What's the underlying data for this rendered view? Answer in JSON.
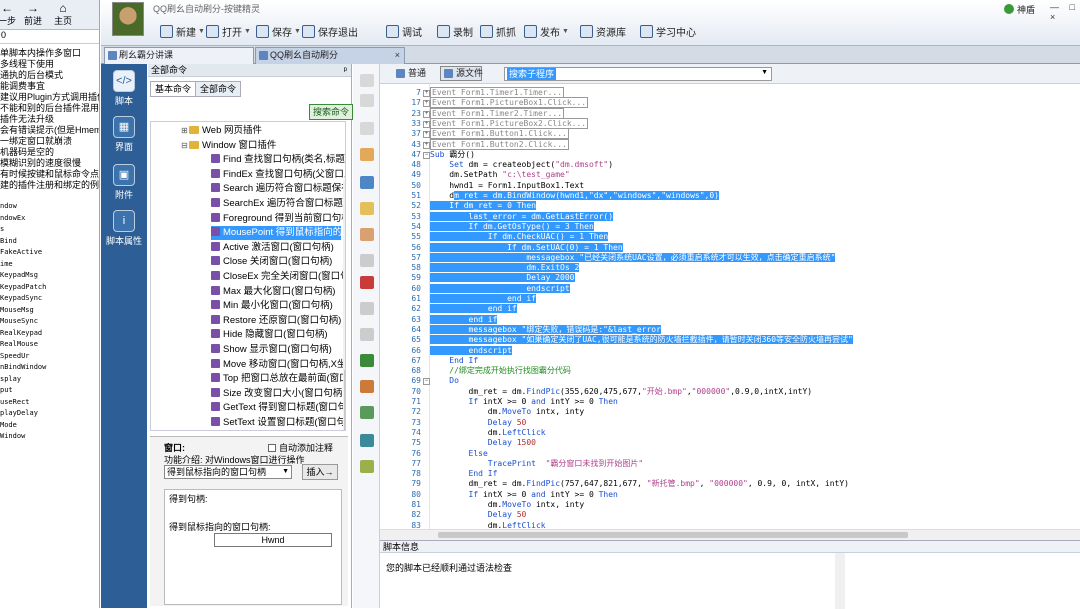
{
  "left_window": {
    "nav": {
      "back": "一步",
      "forward": "前进",
      "home": "主页"
    },
    "address": "0",
    "lines": [
      "单脚本内操作多窗口",
      "多线程下使用",
      "通执的后台模式",
      "能调费事宜",
      "建议用Plugin方式调用插件",
      "不能和别的后台插件混用",
      "插件无法升级",
      "会有错误提示(但是HmemDC",
      "一绑定窗口就崩溃",
      "机器码是空的",
      "模糊识别的速度很慢",
      "有时候按键和鼠标命令点击无效",
      "建的插件注册和绑定的例子"
    ],
    "api_lines": [
      "ndow",
      "ndowEx",
      "s",
      "Bind",
      "FakeActive",
      "ime",
      "KeypadMsg",
      "KeypadPatch",
      "KeypadSync",
      "MouseMsg",
      "MouseSync",
      "RealKeypad",
      "RealMouse",
      "SpeedUr",
      "nBindWindow",
      "",
      "splay",
      "put",
      "useRect",
      "playDelay",
      "Mode",
      "Window"
    ]
  },
  "app": {
    "title": "QQ刷幺自动刷分-按键精灵",
    "help_label": "神盾",
    "window_controls": "— □ ×",
    "toolbar": [
      {
        "label": "新建",
        "icon": "new-file-icon",
        "caret": true
      },
      {
        "label": "打开",
        "icon": "open-folder-icon",
        "caret": true
      },
      {
        "label": "保存",
        "icon": "save-icon",
        "caret": true
      },
      {
        "label": "保存退出",
        "icon": "save-exit-icon",
        "caret": false
      },
      {
        "label": "调试",
        "icon": "debug-icon",
        "caret": false
      },
      {
        "label": "录制",
        "icon": "record-icon",
        "caret": false
      },
      {
        "label": "抓抓",
        "icon": "capture-icon",
        "caret": false
      },
      {
        "label": "发布",
        "icon": "publish-icon",
        "caret": true
      },
      {
        "label": "资源库",
        "icon": "resource-icon",
        "caret": false
      },
      {
        "label": "学习中心",
        "icon": "learning-icon",
        "caret": false
      }
    ],
    "tabs": [
      {
        "label": "刷幺霸分讲课",
        "active": false
      },
      {
        "label": "QQ刷幺自动刷分",
        "active": true
      }
    ]
  },
  "sidebar": [
    {
      "label": "脚本",
      "icon": "script-icon",
      "active": true
    },
    {
      "label": "界面",
      "icon": "interface-icon",
      "active": false
    },
    {
      "label": "附件",
      "icon": "attachment-icon",
      "active": false
    },
    {
      "label": "脚本属性",
      "icon": "info-icon",
      "active": false
    }
  ],
  "commands": {
    "header": "全部命令",
    "pin": "ᵖ",
    "tabs": [
      "基本命令",
      "全部命令"
    ],
    "search_button": "搜索命令",
    "tree": [
      {
        "label": "Web 网页插件",
        "level": 0,
        "type": "folder",
        "expander": "+"
      },
      {
        "label": "Window 窗口插件",
        "level": 0,
        "type": "folder",
        "expander": "−"
      },
      {
        "label": "Find 查找窗口句柄(类名,标题)",
        "level": 1,
        "type": "cmd"
      },
      {
        "label": "FindEx 查找窗口句柄(父窗口,子",
        "level": 1,
        "type": "cmd"
      },
      {
        "label": "Search 遍历符合窗口标题保存",
        "level": 1,
        "type": "cmd"
      },
      {
        "label": "SearchEx 遍历符合窗口标题保",
        "level": 1,
        "type": "cmd"
      },
      {
        "label": "Foreground 得到当前窗口句柄",
        "level": 1,
        "type": "cmd"
      },
      {
        "label": "MousePoint 得到鼠标指向的窗",
        "level": 1,
        "type": "cmd",
        "selected": true
      },
      {
        "label": "Active 激活窗口(窗口句柄)",
        "level": 1,
        "type": "cmd"
      },
      {
        "label": "Close 关闭窗口(窗口句柄)",
        "level": 1,
        "type": "cmd"
      },
      {
        "label": "CloseEx 完全关闭窗口(窗口句",
        "level": 1,
        "type": "cmd"
      },
      {
        "label": "Max 最大化窗口(窗口句柄)",
        "level": 1,
        "type": "cmd"
      },
      {
        "label": "Min 最小化窗口(窗口句柄)",
        "level": 1,
        "type": "cmd"
      },
      {
        "label": "Restore 还原窗口(窗口句柄)",
        "level": 1,
        "type": "cmd"
      },
      {
        "label": "Hide 隐藏窗口(窗口句柄)",
        "level": 1,
        "type": "cmd"
      },
      {
        "label": "Show 显示窗口(窗口句柄)",
        "level": 1,
        "type": "cmd"
      },
      {
        "label": "Move 移动窗口(窗口句柄,X坐标",
        "level": 1,
        "type": "cmd"
      },
      {
        "label": "Top 把窗口总放在最前面(窗口",
        "level": 1,
        "type": "cmd"
      },
      {
        "label": "Size 改变窗口大小(窗口句柄,宽",
        "level": 1,
        "type": "cmd"
      },
      {
        "label": "GetText 得到窗口标题(窗口句",
        "level": 1,
        "type": "cmd"
      },
      {
        "label": "SetText 设置窗口标题(窗口句",
        "level": 1,
        "type": "cmd"
      }
    ],
    "info": {
      "title": "窗口:",
      "auto_comment": "自动添加注释",
      "desc": "功能介绍: 对Windows窗口进行操作",
      "select_value": "得到鼠标指向的窗口句柄",
      "insert_button": "插入→",
      "group_title": "得到句柄:",
      "field_label": "得到鼠标指向的窗口句柄:",
      "field_value": "Hwnd"
    }
  },
  "editor": {
    "view_normal": "普通",
    "view_source": "源文件",
    "sub_select": "搜索子程序",
    "lines": [
      {
        "n": "7",
        "fold": "+",
        "t": [
          [
            "bx",
            "Event Form1.Timer1.Timer..."
          ]
        ]
      },
      {
        "n": "17",
        "fold": "+",
        "t": [
          [
            "bx",
            "Event Form1.PictureBox1.Click..."
          ]
        ]
      },
      {
        "n": "23",
        "fold": "+",
        "t": [
          [
            "bx",
            "Event Form1.Timer2.Timer..."
          ]
        ]
      },
      {
        "n": "33",
        "fold": "+",
        "t": [
          [
            "bx",
            "Event Form1.PictureBox2.Click..."
          ]
        ]
      },
      {
        "n": "37",
        "fold": "+",
        "t": [
          [
            "bx",
            "Event Form1.Button1.Click..."
          ]
        ]
      },
      {
        "n": "43",
        "fold": "+",
        "t": [
          [
            "bx",
            "Event Form1.Button2.Click..."
          ]
        ]
      },
      {
        "n": "47",
        "fold": "−",
        "t": [
          [
            "kw",
            "Sub "
          ],
          [
            "",
            "霸分()"
          ]
        ]
      },
      {
        "n": "48",
        "t": [
          [
            "",
            "    "
          ],
          [
            "kw",
            "Set "
          ],
          [
            "",
            "dm = createobject("
          ],
          [
            "st",
            "\"dm.dmsoft\""
          ],
          [
            "",
            ")"
          ]
        ]
      },
      {
        "n": "49",
        "t": [
          [
            "",
            "    dm.SetPath "
          ],
          [
            "st",
            "\"c:\\test_game\""
          ]
        ]
      },
      {
        "n": "50",
        "t": [
          [
            "",
            "    hwnd1 = Form1.InputBox1.Text"
          ]
        ]
      },
      {
        "n": "51",
        "t": [
          [
            "",
            "    d"
          ],
          [
            "hl",
            "m_ret = dm.BindWindow(hwnd1,\"dx\",\"windows\",\"windows\",0)"
          ]
        ]
      },
      {
        "n": "52",
        "t": [
          [
            "hl",
            "    If dm_ret = 0 Then"
          ]
        ]
      },
      {
        "n": "53",
        "t": [
          [
            "hl",
            "        last_error = dm.GetLastError()"
          ]
        ]
      },
      {
        "n": "54",
        "t": [
          [
            "hl",
            "        If dm.GetOsType() = 3 Then"
          ]
        ]
      },
      {
        "n": "55",
        "t": [
          [
            "hl",
            "            If dm.CheckUAC() = 1 Then"
          ]
        ]
      },
      {
        "n": "56",
        "t": [
          [
            "hl",
            "                If dm.SetUAC(0) = 1 Then"
          ]
        ]
      },
      {
        "n": "57",
        "t": [
          [
            "hl",
            "                    messagebox \"已经关闭系统UAC设置，必须重启系统才可以生效，点击确定重启系统\""
          ]
        ]
      },
      {
        "n": "58",
        "t": [
          [
            "hl",
            "                    dm.ExitOs 2"
          ]
        ]
      },
      {
        "n": "59",
        "t": [
          [
            "hl",
            "                    Delay 2000"
          ]
        ]
      },
      {
        "n": "60",
        "t": [
          [
            "hl",
            "                    endscript"
          ]
        ]
      },
      {
        "n": "61",
        "t": [
          [
            "hl",
            "                end if"
          ]
        ]
      },
      {
        "n": "62",
        "t": [
          [
            "hl",
            "            end if"
          ]
        ]
      },
      {
        "n": "63",
        "t": [
          [
            "hl",
            "        end if"
          ]
        ]
      },
      {
        "n": "64",
        "t": [
          [
            "hl",
            "        messagebox \"绑定失败，错误码是:\"&last_error"
          ]
        ]
      },
      {
        "n": "65",
        "t": [
          [
            "hl",
            "        messagebox \"如果确定关闭了UAC,很可能是系统的防火墙拦截插件，请暂时关闭360等安全防火墙再尝试\""
          ]
        ]
      },
      {
        "n": "66",
        "t": [
          [
            "hl",
            "        endscript"
          ]
        ]
      },
      {
        "n": "67",
        "t": [
          [
            "",
            "    "
          ],
          [
            "kw",
            "End If"
          ]
        ]
      },
      {
        "n": "68",
        "t": [
          [
            "cm",
            "    //绑定完成开始执行找图霸分代码"
          ]
        ]
      },
      {
        "n": "69",
        "fold": "−",
        "t": [
          [
            "",
            "    "
          ],
          [
            "kw",
            "Do"
          ]
        ]
      },
      {
        "n": "70",
        "t": [
          [
            "",
            "        dm_ret = dm."
          ],
          [
            "fn",
            "FindPic"
          ],
          [
            "",
            "(355,620,475,677,"
          ],
          [
            "st",
            "\"开始.bmp\""
          ],
          [
            "",
            ","
          ],
          [
            "st",
            "\"000000\""
          ],
          [
            "",
            ",0.9,0,intX,intY)"
          ]
        ]
      },
      {
        "n": "71",
        "t": [
          [
            "",
            "        "
          ],
          [
            "kw",
            "If "
          ],
          [
            "",
            "intX >= 0 "
          ],
          [
            "kw",
            "and "
          ],
          [
            "",
            "intY >= 0 "
          ],
          [
            "kw",
            "Then"
          ]
        ]
      },
      {
        "n": "72",
        "t": [
          [
            "",
            "            dm."
          ],
          [
            "fn",
            "MoveTo"
          ],
          [
            "",
            " intx, inty"
          ]
        ]
      },
      {
        "n": "73",
        "t": [
          [
            "",
            "            "
          ],
          [
            "fn",
            "Delay"
          ],
          [
            "num",
            " 50"
          ]
        ]
      },
      {
        "n": "74",
        "t": [
          [
            "",
            "            dm."
          ],
          [
            "fn",
            "LeftClick"
          ]
        ]
      },
      {
        "n": "75",
        "t": [
          [
            "",
            "            "
          ],
          [
            "fn",
            "Delay"
          ],
          [
            "num",
            " 1500"
          ]
        ]
      },
      {
        "n": "76",
        "t": [
          [
            "",
            "        "
          ],
          [
            "kw",
            "Else"
          ]
        ]
      },
      {
        "n": "77",
        "t": [
          [
            "",
            "            "
          ],
          [
            "fn",
            "TracePrint "
          ],
          [
            "st",
            " \"霸分窗口未找到开始图片\""
          ]
        ]
      },
      {
        "n": "78",
        "t": [
          [
            "",
            "        "
          ],
          [
            "kw",
            "End If"
          ]
        ]
      },
      {
        "n": "79",
        "t": [
          [
            "",
            "        dm_ret = dm."
          ],
          [
            "fn",
            "FindPic"
          ],
          [
            "",
            "(757,647,821,677, "
          ],
          [
            "st",
            "\"新托管.bmp\""
          ],
          [
            "",
            ", "
          ],
          [
            "st",
            "\"000000\""
          ],
          [
            "",
            ", 0.9, 0, intX, intY)"
          ]
        ]
      },
      {
        "n": "80",
        "t": [
          [
            "",
            "        "
          ],
          [
            "kw",
            "If "
          ],
          [
            "",
            "intX >= 0 "
          ],
          [
            "kw",
            "and "
          ],
          [
            "",
            "intY >= 0 "
          ],
          [
            "kw",
            "Then"
          ]
        ]
      },
      {
        "n": "81",
        "t": [
          [
            "",
            "            dm."
          ],
          [
            "fn",
            "MoveTo"
          ],
          [
            "",
            " intx, inty"
          ]
        ]
      },
      {
        "n": "82",
        "t": [
          [
            "",
            "            "
          ],
          [
            "fn",
            "Delay"
          ],
          [
            "num",
            " 50"
          ]
        ]
      },
      {
        "n": "83",
        "t": [
          [
            "",
            "            dm."
          ],
          [
            "fn",
            "LeftClick"
          ]
        ]
      }
    ]
  },
  "output": {
    "header": "脚本信息",
    "message": "您的脚本已经顺利通过语法检查"
  },
  "colors": {
    "sidebar": "#2d5f96",
    "selection": "#3399ff",
    "keyword": "#1a4fd0",
    "string": "#b0408c",
    "comment": "#208a20"
  }
}
